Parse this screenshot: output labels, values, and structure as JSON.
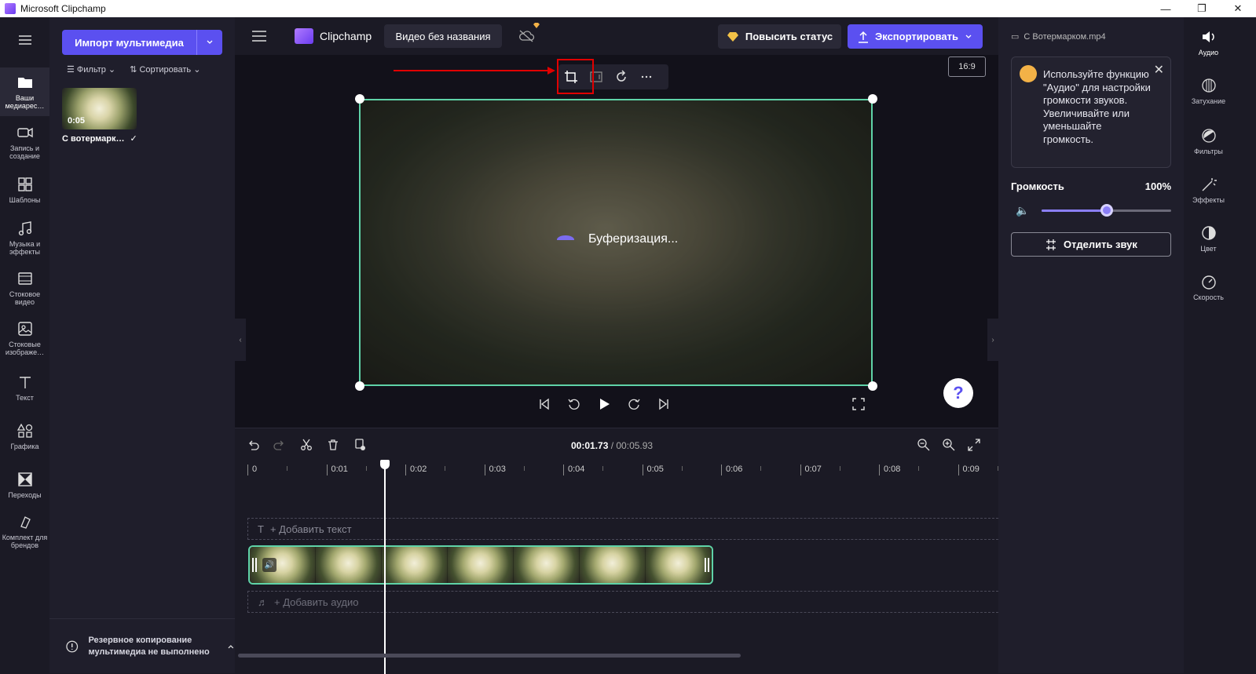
{
  "window": {
    "title": "Microsoft Clipchamp",
    "controls": [
      "—",
      "❐",
      "✕"
    ]
  },
  "left_nav": {
    "items": [
      {
        "label": "Ваши медиарес…",
        "icon": "folder-icon"
      },
      {
        "label": "Запись и создание",
        "icon": "camera-icon"
      },
      {
        "label": "Шаблоны",
        "icon": "templates-icon"
      },
      {
        "label": "Музыка и эффекты",
        "icon": "music-icon"
      },
      {
        "label": "Стоковое видео",
        "icon": "film-icon"
      },
      {
        "label": "Стоковые изображе…",
        "icon": "image-icon"
      },
      {
        "label": "Текст",
        "icon": "text-icon"
      },
      {
        "label": "Графика",
        "icon": "shapes-icon"
      },
      {
        "label": "Переходы",
        "icon": "transitions-icon"
      },
      {
        "label": "Комплект для брендов",
        "icon": "brand-kit-icon"
      }
    ]
  },
  "media_panel": {
    "import_label": "Импорт мультимедиа",
    "filter_label": "Фильтр",
    "sort_label": "Сортировать",
    "media_item": {
      "duration": "0:05",
      "name": "С вотермарк…",
      "check": "✓"
    },
    "backup_text": "Резервное копирование мультимедиа не выполнено"
  },
  "header": {
    "brand": "Clipchamp",
    "project_title": "Видео без названия",
    "upgrade_label": "Повысить статус",
    "export_label": "Экспортировать"
  },
  "preview": {
    "aspect_ratio": "16:9",
    "buffering_text": "Буферизация...",
    "toolbar_icons": [
      "crop-icon",
      "fit-icon",
      "rotate-icon",
      "more-icon"
    ]
  },
  "timeline": {
    "current_time": "00:01.73",
    "total_time": "/ 00:05.93",
    "ruler_labels": [
      "0",
      "0:01",
      "0:02",
      "0:03",
      "0:04",
      "0:05",
      "0:06",
      "0:07",
      "0:08",
      "0:09"
    ],
    "add_text_label": "+ Добавить текст",
    "add_audio_label": "+ Добавить аудио",
    "playhead_time_sec": 1.73
  },
  "right_panel": {
    "file_name": "С Вотермарком.mp4",
    "tip_text": "Используйте функцию \"Аудио\" для настройки громкости звуков. Увеличивайте или уменьшайте громкость.",
    "volume_label": "Громкость",
    "volume_value": "100%",
    "volume_level": 0.5,
    "detach_label": "Отделить звук"
  },
  "right_nav": {
    "items": [
      {
        "label": "Аудио",
        "icon": "audio-icon"
      },
      {
        "label": "Затухание",
        "icon": "fade-icon"
      },
      {
        "label": "Фильтры",
        "icon": "filters-icon"
      },
      {
        "label": "Эффекты",
        "icon": "effects-icon"
      },
      {
        "label": "Цвет",
        "icon": "color-icon"
      },
      {
        "label": "Скорость",
        "icon": "speed-icon"
      }
    ]
  },
  "colors": {
    "accent": "#5b50f0",
    "selection": "#5fd3a8",
    "annotation": "#e00000"
  }
}
